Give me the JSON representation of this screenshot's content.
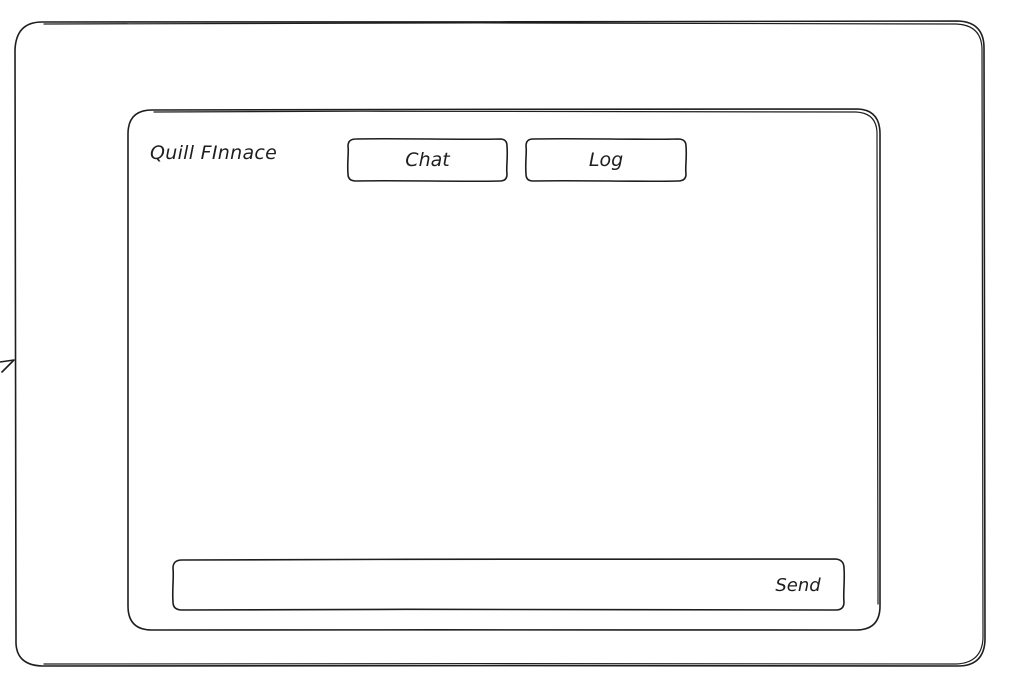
{
  "app": {
    "title": "Quill FInnace"
  },
  "tabs": [
    {
      "label": "Chat"
    },
    {
      "label": "Log"
    }
  ],
  "composer": {
    "value": "",
    "placeholder": "",
    "send_label": "Send"
  },
  "colors": {
    "ink": "#1e1e1e",
    "background": "#ffffff"
  }
}
